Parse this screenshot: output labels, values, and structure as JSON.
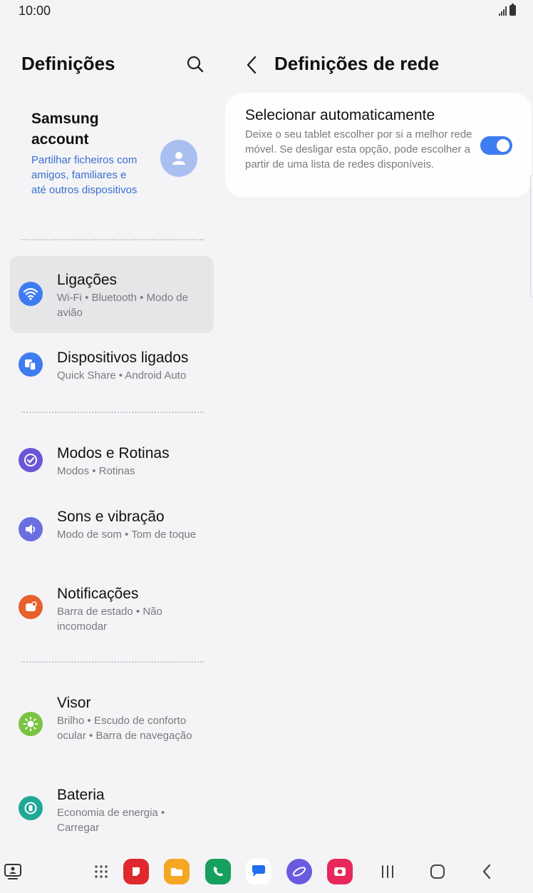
{
  "status": {
    "time": "10:00"
  },
  "left_pane": {
    "title": "Definições",
    "account": {
      "name": "Samsung account",
      "description": "Partilhar ficheiros com amigos, familiares e até outros dispositivos"
    },
    "items": [
      {
        "title": "Ligações",
        "subtitle": "Wi-Fi • Bluetooth • Modo de avião",
        "icon": "wifi-icon",
        "color": "#3e7cf1",
        "active": true
      },
      {
        "title": "Dispositivos ligados",
        "subtitle": "Quick Share • Android Auto",
        "icon": "connected-devices-icon",
        "color": "#3e7cf1"
      },
      {
        "title": "Modos e Rotinas",
        "subtitle": "Modos • Rotinas",
        "icon": "check-circle-icon",
        "color": "#6a56d6"
      },
      {
        "title": "Sons e vibração",
        "subtitle": "Modo de som • Tom de toque",
        "icon": "speaker-icon",
        "color": "#6a6fe0"
      },
      {
        "title": "Notificações",
        "subtitle": "Barra de estado • Não incomodar",
        "icon": "notification-icon",
        "color": "#e8602c"
      },
      {
        "title": "Visor",
        "subtitle": "Brilho • Escudo de conforto ocular • Barra de navegação",
        "icon": "sun-icon",
        "color": "#7ac443"
      },
      {
        "title": "Bateria",
        "subtitle": "Economia de energia • Carregar",
        "icon": "battery-icon",
        "color": "#1fa896"
      }
    ]
  },
  "right_pane": {
    "title": "Definições de rede",
    "setting": {
      "title": "Selecionar automaticamente",
      "description": "Deixe o seu tablet escolher por si a melhor rede móvel. Se desligar esta opção, pode escolher a partir de uma lista de redes disponíveis.",
      "enabled": true
    }
  },
  "taskbar": {
    "apps": [
      {
        "name": "app-drawer-icon"
      },
      {
        "name": "notes-app-icon",
        "color": "#e0282f"
      },
      {
        "name": "my-files-app-icon",
        "color": "#f5a623"
      },
      {
        "name": "phone-app-icon",
        "color": "#16a05d"
      },
      {
        "name": "messages-app-icon",
        "color": "#1f6ff0"
      },
      {
        "name": "internet-app-icon",
        "color": "#6a5ae0"
      },
      {
        "name": "camera-app-icon",
        "color": "#e8285a"
      }
    ]
  }
}
